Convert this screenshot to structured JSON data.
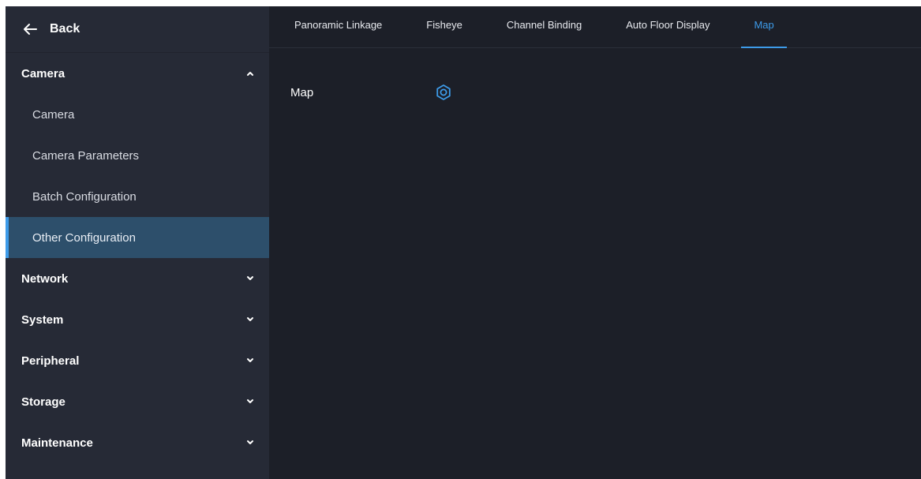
{
  "sidebar": {
    "back_label": "Back",
    "groups": [
      {
        "label": "Camera",
        "expanded": true,
        "items": [
          {
            "label": "Camera",
            "active": false
          },
          {
            "label": "Camera Parameters",
            "active": false
          },
          {
            "label": "Batch Configuration",
            "active": false
          },
          {
            "label": "Other Configuration",
            "active": true
          }
        ]
      },
      {
        "label": "Network",
        "expanded": false
      },
      {
        "label": "System",
        "expanded": false
      },
      {
        "label": "Peripheral",
        "expanded": false
      },
      {
        "label": "Storage",
        "expanded": false
      },
      {
        "label": "Maintenance",
        "expanded": false
      }
    ]
  },
  "tabs": [
    {
      "label": "Panoramic Linkage",
      "active": false
    },
    {
      "label": "Fisheye",
      "active": false
    },
    {
      "label": "Channel Binding",
      "active": false
    },
    {
      "label": "Auto Floor Display",
      "active": false
    },
    {
      "label": "Map",
      "active": true
    }
  ],
  "content": {
    "map_label": "Map",
    "map_icon": "settings-hexagon-icon"
  },
  "colors": {
    "accent": "#3d9be9",
    "sidebar_bg": "#262a36",
    "main_bg": "#1c1f28",
    "active_item_bg": "#2d4f6b"
  }
}
